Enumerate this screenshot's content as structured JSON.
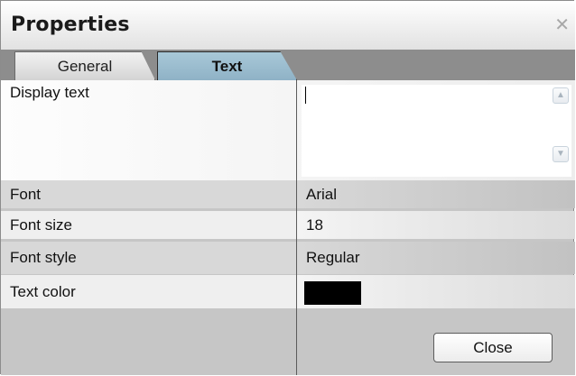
{
  "window": {
    "title": "Properties",
    "close_glyph": "✕"
  },
  "tabs": [
    {
      "label": "General",
      "active": false
    },
    {
      "label": "Text",
      "active": true
    }
  ],
  "properties": {
    "display_text": {
      "label": "Display text",
      "value": ""
    },
    "font": {
      "label": "Font",
      "value": "Arial"
    },
    "font_size": {
      "label": "Font size",
      "value": "18"
    },
    "font_style": {
      "label": "Font style",
      "value": "Regular"
    },
    "text_color": {
      "label": "Text color",
      "value": "#000000"
    }
  },
  "scroll": {
    "up_glyph": "▲",
    "down_glyph": "▼"
  },
  "footer": {
    "close_label": "Close"
  },
  "colors": {
    "active_tab": "#97b8ca",
    "tabstrip": "#8d8d8d",
    "panel": "#c6c6c6"
  }
}
